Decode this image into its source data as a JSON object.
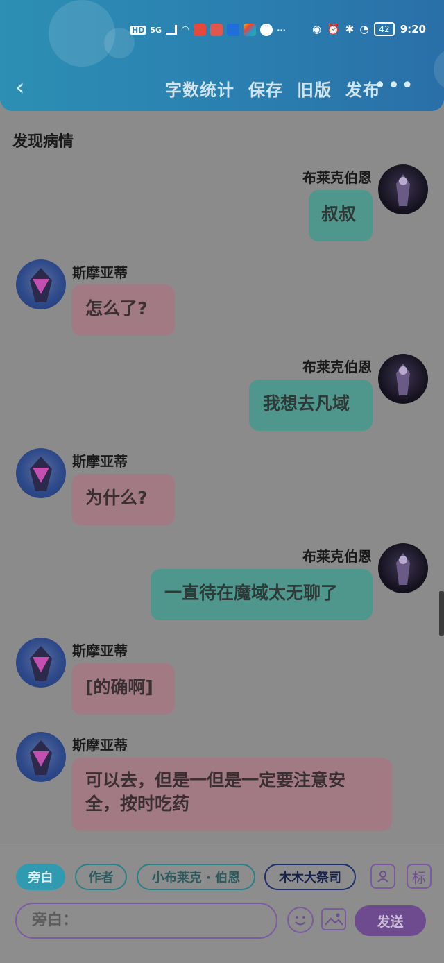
{
  "statusbar": {
    "hd": "HD",
    "signal": "5G",
    "more": "···",
    "battery": "42",
    "time": "9:20"
  },
  "toolbar": {
    "back_icon": "chevron-left",
    "word_count": "字数统计",
    "save": "保存",
    "old_version": "旧版",
    "publish": "发布",
    "more": "•••"
  },
  "chat": {
    "title": "发现病情",
    "messages": [
      {
        "side": "right",
        "name": "布莱克伯恩",
        "text": "叔叔"
      },
      {
        "side": "left",
        "name": "斯摩亚蒂",
        "text": "怎么了?"
      },
      {
        "side": "right",
        "name": "布莱克伯恩",
        "text": "我想去凡域"
      },
      {
        "side": "left",
        "name": "斯摩亚蒂",
        "text": "为什么?"
      },
      {
        "side": "right",
        "name": "布莱克伯恩",
        "text": "一直待在魔域太无聊了"
      },
      {
        "side": "left",
        "name": "斯摩亚蒂",
        "text": "[的确啊]"
      },
      {
        "side": "left",
        "name": "斯摩亚蒂",
        "text": "可以去，但是一但是一定要注意安全，按时吃药"
      }
    ]
  },
  "roles": {
    "narration": "旁白",
    "author": "作者",
    "char1": "小布莱克 · 伯恩",
    "char2": "木木大祭司",
    "mark": "标"
  },
  "input": {
    "value": "旁白：",
    "send": "发送"
  },
  "colors": {
    "header": "#2a7fb0",
    "right_bubble": "#4f978d",
    "left_bubble": "#a27a84",
    "accent_purple": "#6e4a8f"
  }
}
